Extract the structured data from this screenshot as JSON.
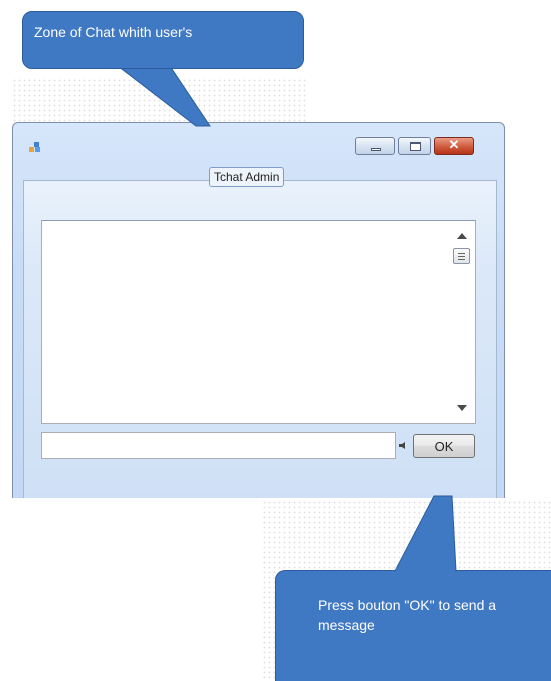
{
  "annotations": {
    "top_callout": "Zone of Chat whith user's",
    "bottom_callout": "Press bouton \"OK\" to send a message"
  },
  "window": {
    "group_title": "Tchat Admin",
    "controls": {
      "minimize_icon": "minimize-icon",
      "maximize_icon": "maximize-icon",
      "close_icon": "close-icon",
      "close_glyph": "✕"
    }
  },
  "chat": {
    "messages": [],
    "input_value": "",
    "send_label": "OK"
  },
  "colors": {
    "callout_fill": "#3f78c3",
    "close_button": "#d05a3c",
    "window_frame": "#c8dcf5"
  }
}
